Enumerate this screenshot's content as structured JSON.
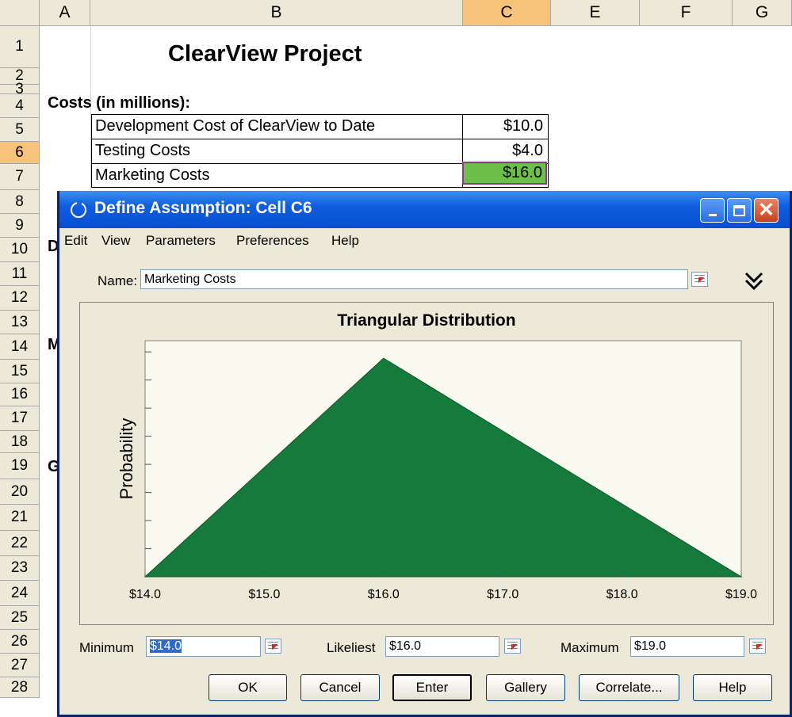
{
  "sheet": {
    "columns": [
      "A",
      "B",
      "C",
      "E",
      "F",
      "G"
    ],
    "selected_column": "C",
    "rows": [
      "1",
      "2",
      "3",
      "4",
      "5",
      "6",
      "7",
      "8",
      "9",
      "10",
      "11",
      "12",
      "13",
      "14",
      "15",
      "16",
      "17",
      "18",
      "19",
      "20",
      "21",
      "22",
      "23",
      "24",
      "25",
      "26",
      "27",
      "28"
    ],
    "selected_row": "6",
    "title": "ClearView Project",
    "costs_heading": "Costs (in millions):",
    "costs": [
      {
        "label": "Development Cost of ClearView to Date",
        "value": "$10.0"
      },
      {
        "label": "Testing Costs",
        "value": "$4.0"
      },
      {
        "label": "Marketing Costs",
        "value": "$16.0"
      }
    ],
    "partial_labels": {
      "row9": "D",
      "row13": "M",
      "row18": "G"
    }
  },
  "dialog": {
    "title": "Define Assumption: Cell C6",
    "menu": [
      "Edit",
      "View",
      "Parameters",
      "Preferences",
      "Help"
    ],
    "name_label": "Name:",
    "name_value": "Marketing Costs",
    "params": {
      "minimum_label": "Minimum",
      "minimum_value": "$14.0",
      "likeliest_label": "Likeliest",
      "likeliest_value": "$16.0",
      "maximum_label": "Maximum",
      "maximum_value": "$19.0"
    },
    "buttons": {
      "ok": "OK",
      "cancel": "Cancel",
      "enter": "Enter",
      "gallery": "Gallery",
      "correlate": "Correlate...",
      "help": "Help"
    },
    "colors": {
      "titlebar": "#0a4fd0",
      "fill": "#167a3c",
      "highlight_cell": "#6cc04a"
    },
    "icons": [
      "cycle-icon",
      "minimize-icon",
      "maximize-icon",
      "close-icon",
      "cell-reference-icon",
      "expand-double-chevron-icon"
    ]
  },
  "chart_data": {
    "type": "area",
    "title": "Triangular Distribution",
    "xlabel": "",
    "ylabel": "Probability",
    "x": [
      14.0,
      16.0,
      19.0
    ],
    "y": [
      0,
      1,
      0
    ],
    "xlim": [
      14.0,
      19.0
    ],
    "ylim": [
      0,
      1.08
    ],
    "x_ticks": [
      "$14.0",
      "$15.0",
      "$16.0",
      "$17.0",
      "$18.0",
      "$19.0"
    ],
    "x_tick_values": [
      14,
      15,
      16,
      17,
      18,
      19
    ],
    "y_tick_count": 8,
    "grid": false,
    "color": "#167a3c"
  }
}
